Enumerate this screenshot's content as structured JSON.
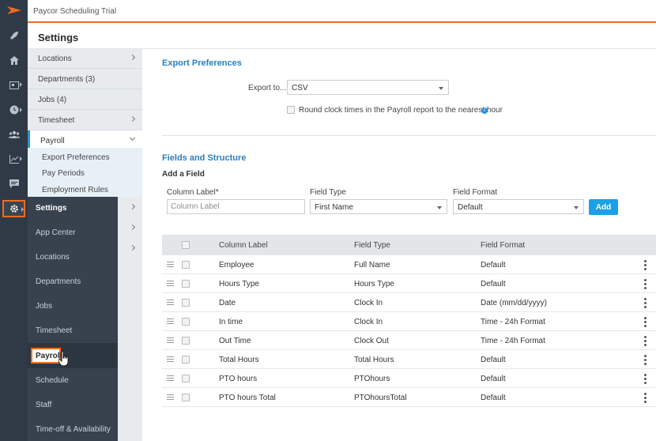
{
  "app": {
    "title": "Paycor Scheduling Trial",
    "accent": "#f26b21",
    "link_color": "#2b7fc0"
  },
  "rail": {
    "items": [
      {
        "name": "rocket-icon"
      },
      {
        "name": "home-icon"
      },
      {
        "name": "calendar-icon"
      },
      {
        "name": "clock-icon"
      },
      {
        "name": "team-icon"
      },
      {
        "name": "analytics-icon"
      },
      {
        "name": "chat-icon"
      },
      {
        "name": "gear-icon"
      }
    ]
  },
  "settings": {
    "header": "Settings",
    "nav": {
      "locations": "Locations",
      "departments": "Departments (3)",
      "jobs": "Jobs (4)",
      "timesheet": "Timesheet",
      "payroll": "Payroll",
      "payroll_sub": [
        "Export Preferences",
        "Pay Periods",
        "Employment Rules"
      ]
    }
  },
  "flyout": {
    "items": [
      "Settings",
      "App Center",
      "Locations",
      "Departments",
      "Jobs",
      "Timesheet",
      "Payroll",
      "Schedule",
      "Staff",
      "Time-off & Availability"
    ]
  },
  "export": {
    "section_title": "Export Preferences",
    "export_to_label": "Export to...",
    "export_to_value": "CSV",
    "round_label": "Round clock times in the Payroll report to the nearest hour"
  },
  "fields": {
    "section_title": "Fields and Structure",
    "add_field_label": "Add a Field",
    "column_label_header": "Column Label*",
    "field_type_header": "Field Type",
    "field_format_header": "Field Format",
    "column_label_placeholder": "Column Label",
    "field_type_value": "First Name",
    "field_format_value": "Default",
    "add_button": "Add"
  },
  "table": {
    "headers": [
      "Column Label",
      "Field Type",
      "Field Format"
    ],
    "rows": [
      {
        "label": "Employee",
        "type": "Full Name",
        "format": "Default"
      },
      {
        "label": "Hours Type",
        "type": "Hours Type",
        "format": "Default"
      },
      {
        "label": "Date",
        "type": "Clock In",
        "format": "Date (mm/dd/yyyy)"
      },
      {
        "label": "In time",
        "type": "Clock In",
        "format": "Time - 24h Format"
      },
      {
        "label": "Out Time",
        "type": "Clock Out",
        "format": "Time - 24h Format"
      },
      {
        "label": "Total Hours",
        "type": "Total Hours",
        "format": "Default"
      },
      {
        "label": "PTO hours",
        "type": "PTOhours",
        "format": "Default"
      },
      {
        "label": "PTO hours Total",
        "type": "PTOhoursTotal",
        "format": "Default"
      }
    ]
  }
}
